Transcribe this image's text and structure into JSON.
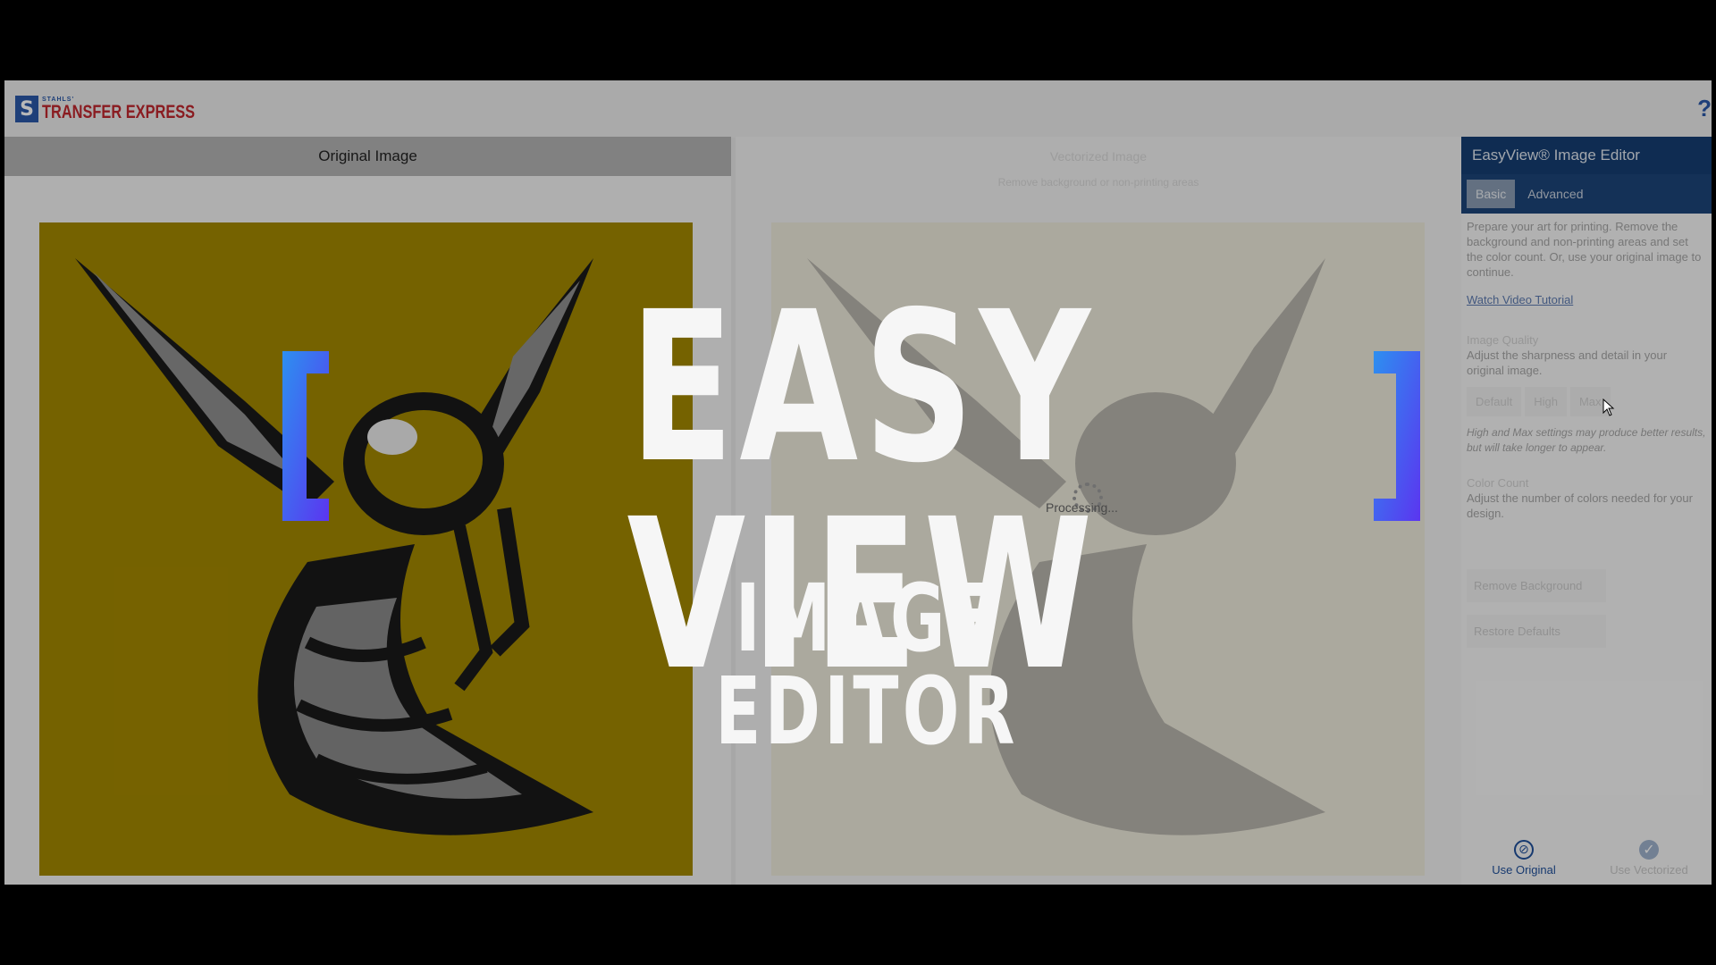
{
  "header": {
    "brand_small": "STAHLS'",
    "brand_name": "TRANSFER EXPRESS",
    "brand_mark": "S",
    "help_label": "?"
  },
  "original_panel": {
    "title": "Original Image"
  },
  "vectorized_panel": {
    "title": "Vectorized Image",
    "subtitle": "Remove background or non-printing areas",
    "processing_text": "Processing..."
  },
  "tools": [
    "eraser-icon",
    "magnifier-icon",
    "hand-icon"
  ],
  "editor": {
    "title": "EasyView® Image Editor",
    "tabs": [
      {
        "label": "Basic",
        "active": true
      },
      {
        "label": "Advanced",
        "active": false
      }
    ],
    "intro": "Prepare your art for printing. Remove the background and non-printing areas and set the color count. Or, use your original image to continue.",
    "tutorial_link": "Watch Video Tutorial",
    "image_quality": {
      "label": "Image Quality",
      "description": "Adjust the sharpness and detail in your original image.",
      "options": [
        "Default",
        "High",
        "Max"
      ],
      "note": "High and Max settings may produce better results, but will take longer to appear."
    },
    "color_count": {
      "label": "Color Count",
      "description": "Adjust the number of colors needed for your design."
    },
    "remove_background": "Remove Background",
    "restore_defaults": "Restore Defaults",
    "use_original": "Use Original",
    "use_vectorized": "Use Vectorized"
  },
  "overlay": {
    "bracket_left": "[",
    "title": "EASY VIEW",
    "bracket_right": "]",
    "subtitle": "IMAGE EDITOR"
  },
  "colors": {
    "brand_blue": "#2a58a8",
    "brand_red": "#c0282e",
    "editor_header": "#153d72",
    "artwork_background": "#a38800",
    "bracket_gradient_start": "#2d8ff0",
    "bracket_gradient_end": "#5b35f0"
  }
}
